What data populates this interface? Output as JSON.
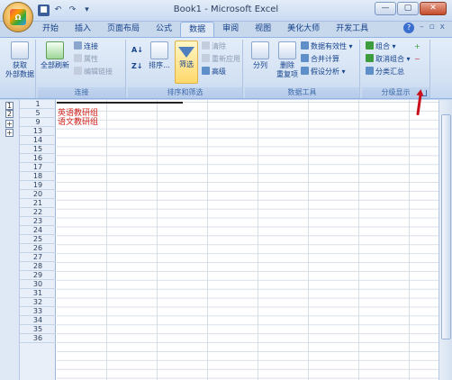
{
  "window": {
    "title": "Book1 - Microsoft Excel",
    "minimize": "—",
    "restore": "▢",
    "close": "✕"
  },
  "office_logo": "Ω",
  "qat": {
    "save": "■",
    "undo": "↶",
    "redo": "↷",
    "more": "▾"
  },
  "tabs": [
    "开始",
    "插入",
    "页面布局",
    "公式",
    "数据",
    "审阅",
    "视图",
    "美化大师",
    "开发工具"
  ],
  "active_tab": "数据",
  "help": {
    "q": "?",
    "min": "–",
    "restore": "▫",
    "close": "x"
  },
  "ribbon": {
    "get_external": {
      "label": "获取\n外部数据"
    },
    "connections": {
      "label": "连接",
      "refresh_all": "全部刷新",
      "conn": "连接",
      "props": "属性",
      "edit_links": "编辑链接"
    },
    "sort_filter": {
      "label": "排序和筛选",
      "sort": "排序...",
      "filter": "筛选",
      "clear": "清除",
      "reapply": "重新应用",
      "advanced": "高级"
    },
    "data_tools": {
      "label": "数据工具",
      "split": "分列",
      "remove_dup": "删除\n重复项",
      "validation": "数据有效性",
      "consolidate": "合并计算",
      "whatif": "假设分析"
    },
    "outline": {
      "label": "分级显示",
      "group": "组合",
      "ungroup": "取消组合",
      "subtotal": "分类汇总"
    }
  },
  "outline_levels": {
    "level1": "1",
    "level2": "2"
  },
  "rows": [
    "1",
    "5",
    "9",
    "13",
    "14",
    "15",
    "16",
    "17",
    "18",
    "19",
    "20",
    "21",
    "22",
    "23",
    "24",
    "25",
    "26",
    "27",
    "28",
    "29",
    "30",
    "31",
    "32",
    "33",
    "34",
    "35",
    "36"
  ],
  "cells": {
    "r5": "英语教研组",
    "r9": "语文教研组"
  },
  "colors": {
    "accent": "#d0211a",
    "ribbon": "#dfe9f6",
    "annotation": "#c8101c"
  }
}
